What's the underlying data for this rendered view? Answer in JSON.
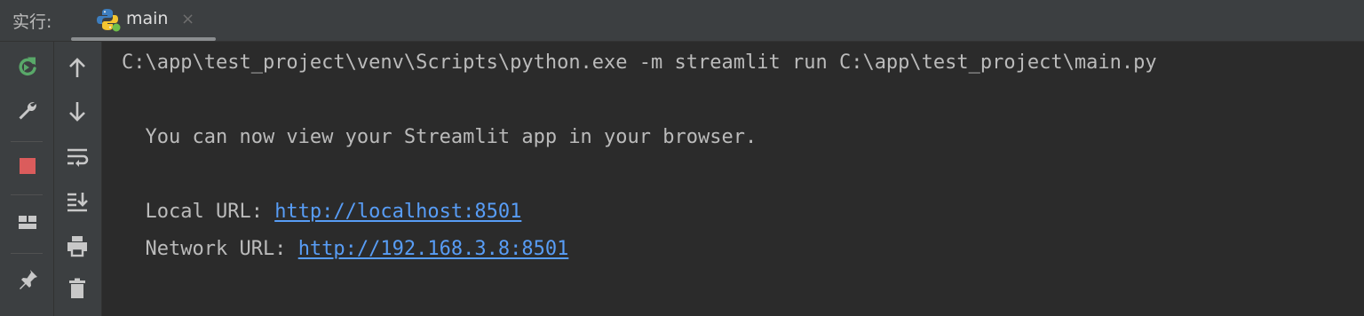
{
  "header": {
    "run_label": "实行:",
    "tab": {
      "title": "main",
      "close": "×",
      "icon": "python-file-icon"
    }
  },
  "left_toolbar": {
    "primary": [
      "rerun-icon",
      "wrench-icon",
      "stop-icon",
      "layout-icon",
      "pin-icon"
    ],
    "secondary": [
      "arrow-up-icon",
      "arrow-down-icon",
      "soft-wrap-icon",
      "scroll-to-end-icon",
      "print-icon",
      "trash-icon"
    ]
  },
  "console": {
    "command": "C:\\app\\test_project\\venv\\Scripts\\python.exe -m streamlit run C:\\app\\test_project\\main.py",
    "message": "  You can now view your Streamlit app in your browser.",
    "local_label": "  Local URL: ",
    "local_url": "http://localhost:8501",
    "network_label": "  Network URL: ",
    "network_url": "http://192.168.3.8:8501"
  },
  "colors": {
    "background": "#2b2b2b",
    "toolbar": "#3c3f41",
    "text": "#bbbbbb",
    "link": "#589df6",
    "stop": "#db5c5c",
    "rerun": "#59a869"
  }
}
